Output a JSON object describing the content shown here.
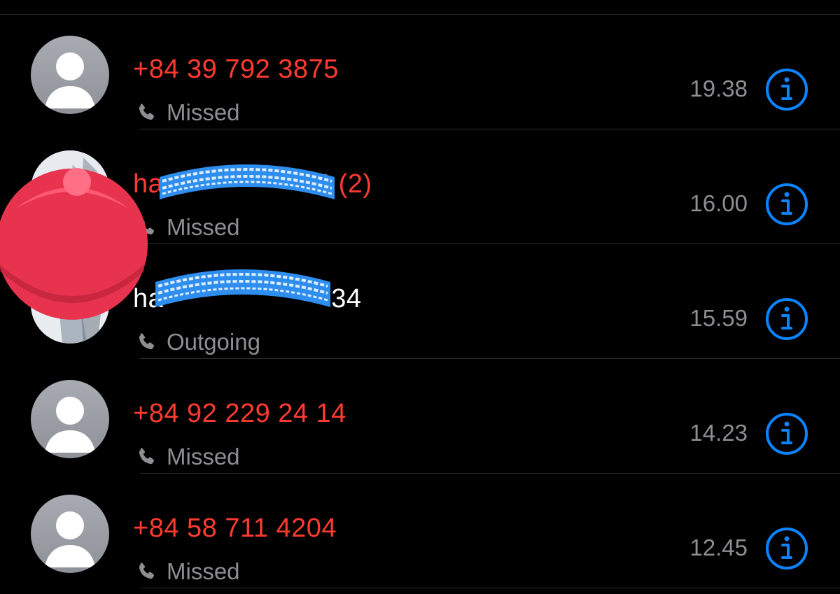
{
  "calls": [
    {
      "name": "+84 39 792 3875",
      "type": "Missed",
      "time": "19.38",
      "status": "missed",
      "avatar": "placeholder"
    },
    {
      "name": "ha……34 (2)",
      "name_visible_prefix": "ha",
      "name_visible_suffix": "34 (2)",
      "type": "Missed",
      "time": "16.00",
      "status": "missed",
      "avatar": "photo"
    },
    {
      "name": "ha……34",
      "name_visible_prefix": "ha",
      "name_visible_suffix": "34",
      "type": "Outgoing",
      "time": "15.59",
      "status": "outgoing",
      "avatar": "photo"
    },
    {
      "name": "+84 92 229 24 14",
      "type": "Missed",
      "time": "14.23",
      "status": "missed",
      "avatar": "placeholder"
    },
    {
      "name": "+84 58 711 4204",
      "type": "Missed",
      "time": "12.45",
      "status": "missed",
      "avatar": "placeholder"
    }
  ],
  "colors": {
    "missed": "#ff3b30",
    "outgoing": "#ffffff",
    "secondary": "#8e8e93",
    "accent": "#0a84ff",
    "background": "#000000"
  },
  "icons": {
    "phone": "phone-icon",
    "info": "info-icon",
    "avatar": "person-icon"
  }
}
